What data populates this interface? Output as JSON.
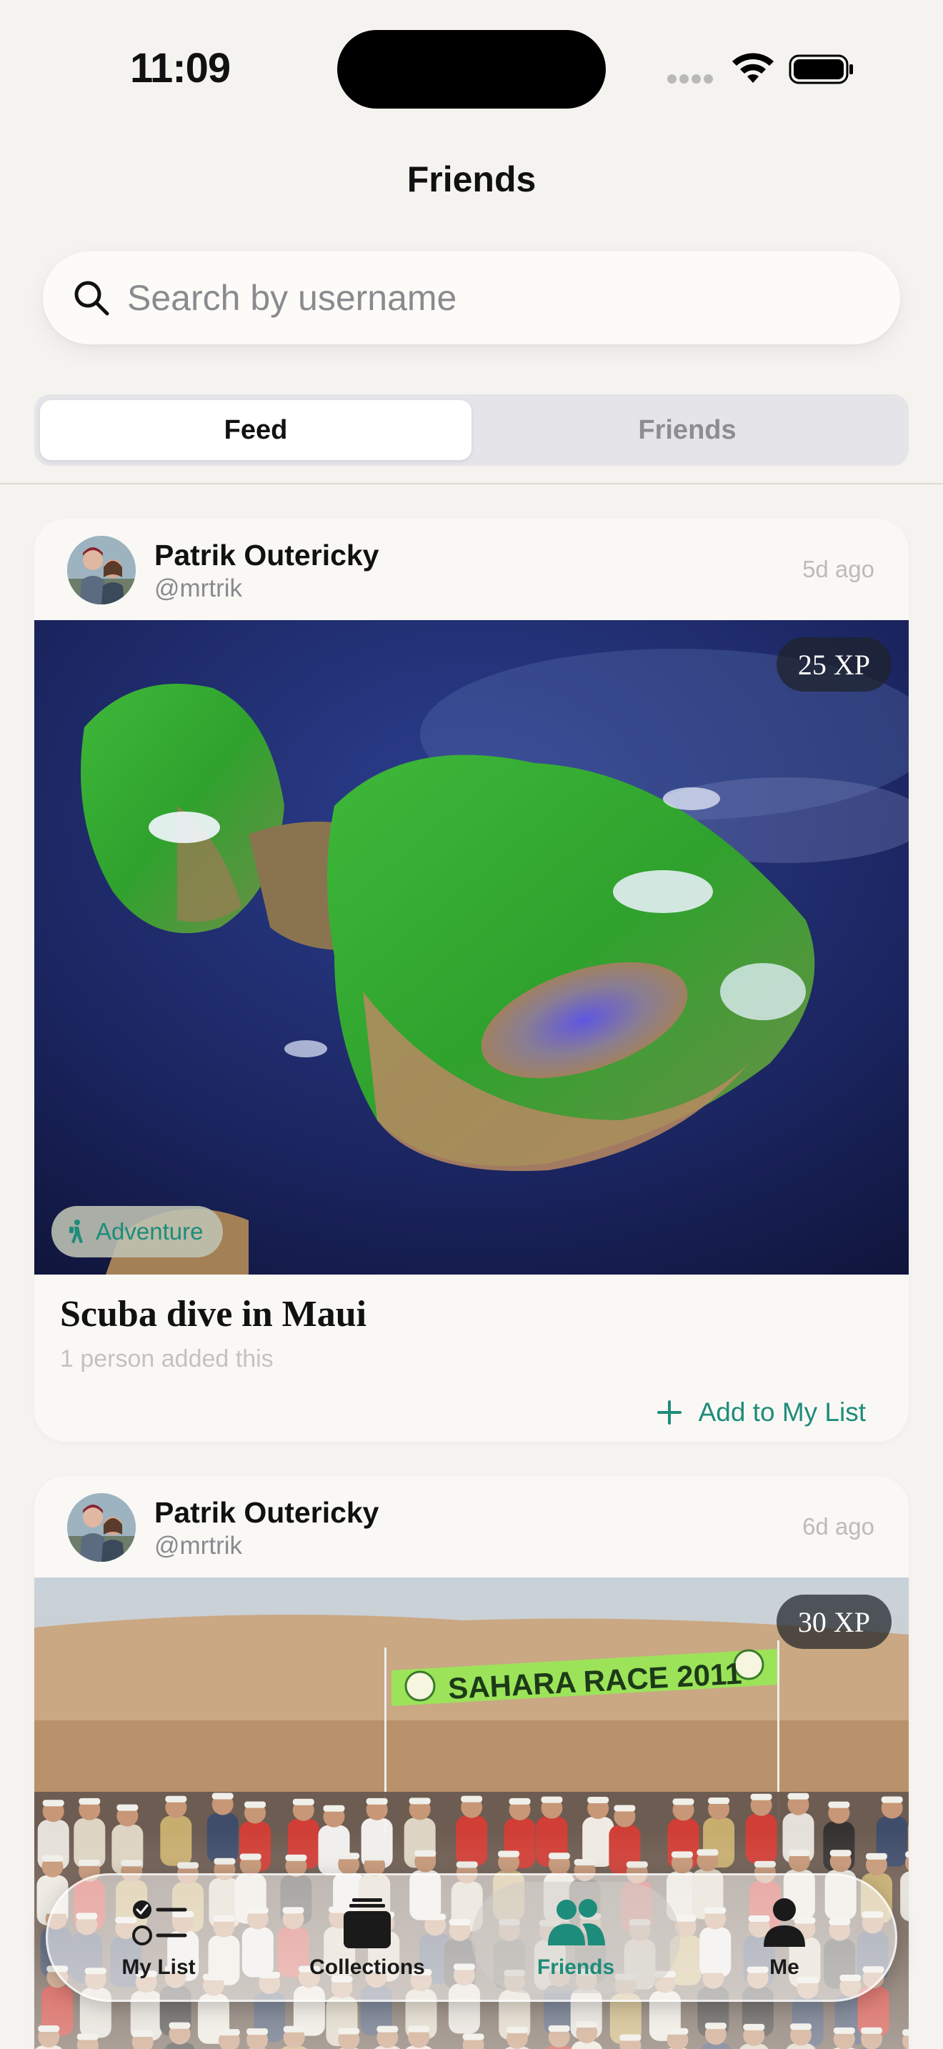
{
  "status_bar": {
    "time": "11:09"
  },
  "header": {
    "title": "Friends"
  },
  "search": {
    "placeholder": "Search by username",
    "value": ""
  },
  "segments": [
    {
      "label": "Feed",
      "active": true
    },
    {
      "label": "Friends",
      "active": false
    }
  ],
  "feed": [
    {
      "user_name": "Patrik Outericky",
      "user_handle": "@mrtrik",
      "time_ago": "5d ago",
      "xp": "25 XP",
      "category": "Adventure",
      "title": "Scuba dive in Maui",
      "added_count": "1 person added this",
      "add_label": "Add to My List"
    },
    {
      "user_name": "Patrik Outericky",
      "user_handle": "@mrtrik",
      "time_ago": "6d ago",
      "xp": "30 XP",
      "image_banner_text": "SAHARA RACE 2011"
    }
  ],
  "tab_bar": [
    {
      "label": "My List",
      "icon": "checklist-icon",
      "active": false
    },
    {
      "label": "Collections",
      "icon": "stack-icon",
      "active": false
    },
    {
      "label": "Friends",
      "icon": "people-icon",
      "active": true
    },
    {
      "label": "Me",
      "icon": "person-icon",
      "active": false
    }
  ],
  "colors": {
    "accent": "#1E8C7A",
    "background": "#F5F3EF"
  }
}
